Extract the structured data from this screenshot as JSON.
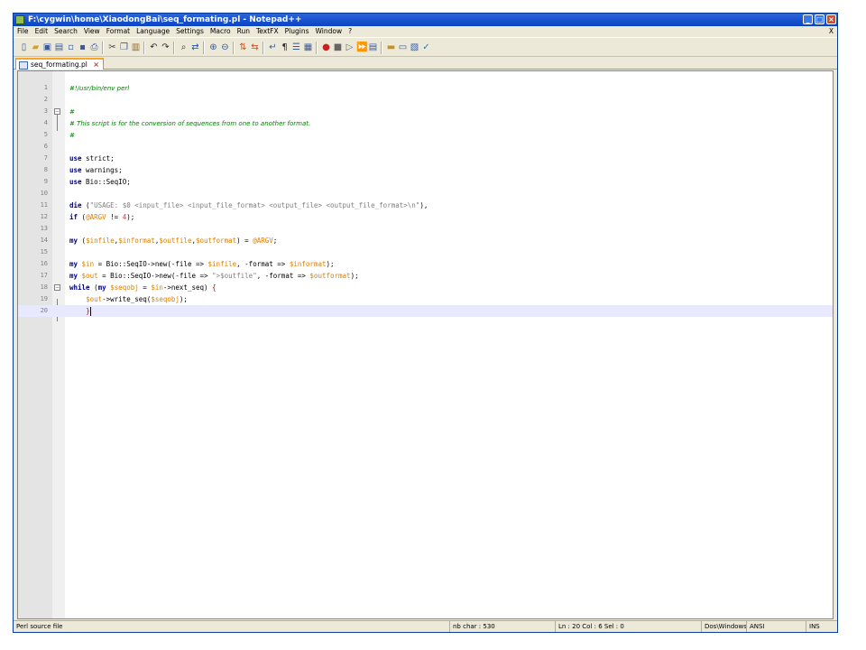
{
  "window": {
    "title": "F:\\cygwin\\home\\XiaodongBai\\seq_formating.pl - Notepad++",
    "controls": {
      "minimize": "_",
      "maximize": "□",
      "close": "×"
    }
  },
  "menu": {
    "items": [
      "File",
      "Edit",
      "Search",
      "View",
      "Format",
      "Language",
      "Settings",
      "Macro",
      "Run",
      "TextFX",
      "Plugins",
      "Window",
      "?"
    ],
    "close_doc": "X"
  },
  "toolbar": {
    "icons": [
      "new-file-icon",
      "open-file-icon",
      "save-icon",
      "save-all-icon",
      "close-icon",
      "close-all-icon",
      "print-icon",
      "cut-icon",
      "copy-icon",
      "paste-icon",
      "undo-icon",
      "redo-icon",
      "find-icon",
      "replace-icon",
      "zoom-in-icon",
      "zoom-out-icon",
      "sync-v-icon",
      "sync-h-icon",
      "wrap-icon",
      "all-chars-icon",
      "indent-guide-icon",
      "doc-map-icon",
      "record-macro-icon",
      "stop-macro-icon",
      "play-macro-icon",
      "run-macro-multi-icon",
      "save-macro-icon",
      "tool-a-icon",
      "tool-b-icon",
      "tool-c-icon",
      "tool-d-icon"
    ]
  },
  "tabs": [
    {
      "label": "seq_formating.pl",
      "close": "×"
    }
  ],
  "editor": {
    "lines": [
      {
        "n": "1",
        "segs": [
          {
            "t": "#!/usr/bin/env perl",
            "c": "cmt"
          }
        ]
      },
      {
        "n": "2",
        "segs": []
      },
      {
        "n": "3",
        "segs": [
          {
            "t": "#",
            "c": "cmt"
          }
        ]
      },
      {
        "n": "4",
        "segs": [
          {
            "t": "# This script is for the conversion of sequences from one to another format.",
            "c": "cmt"
          }
        ]
      },
      {
        "n": "5",
        "segs": [
          {
            "t": "#",
            "c": "cmt"
          }
        ]
      },
      {
        "n": "6",
        "segs": []
      },
      {
        "n": "7",
        "segs": [
          {
            "t": "use",
            "c": "kw"
          },
          {
            "t": " strict;",
            "c": ""
          }
        ]
      },
      {
        "n": "8",
        "segs": [
          {
            "t": "use",
            "c": "kw"
          },
          {
            "t": " warnings;",
            "c": ""
          }
        ]
      },
      {
        "n": "9",
        "segs": [
          {
            "t": "use",
            "c": "kw"
          },
          {
            "t": " Bio::SeqIO;",
            "c": ""
          }
        ]
      },
      {
        "n": "10",
        "segs": []
      },
      {
        "n": "11",
        "segs": [
          {
            "t": "die",
            "c": "kw"
          },
          {
            "t": " (",
            "c": ""
          },
          {
            "t": "\"USAGE: $0 <input_file> <input_file_format> <output_file> <output_file_format>\\n\"",
            "c": "str"
          },
          {
            "t": "),",
            "c": ""
          }
        ]
      },
      {
        "n": "12",
        "segs": [
          {
            "t": "if",
            "c": "kw"
          },
          {
            "t": " (",
            "c": ""
          },
          {
            "t": "@ARGV",
            "c": "var"
          },
          {
            "t": " != ",
            "c": ""
          },
          {
            "t": "4",
            "c": "num"
          },
          {
            "t": ");",
            "c": ""
          }
        ]
      },
      {
        "n": "13",
        "segs": []
      },
      {
        "n": "14",
        "segs": [
          {
            "t": "my",
            "c": "kw"
          },
          {
            "t": " (",
            "c": ""
          },
          {
            "t": "$infile",
            "c": "var"
          },
          {
            "t": ",",
            "c": ""
          },
          {
            "t": "$informat",
            "c": "var"
          },
          {
            "t": ",",
            "c": ""
          },
          {
            "t": "$outfile",
            "c": "var"
          },
          {
            "t": ",",
            "c": ""
          },
          {
            "t": "$outformat",
            "c": "var"
          },
          {
            "t": ") = ",
            "c": ""
          },
          {
            "t": "@ARGV",
            "c": "var"
          },
          {
            "t": ";",
            "c": ""
          }
        ]
      },
      {
        "n": "15",
        "segs": []
      },
      {
        "n": "16",
        "segs": [
          {
            "t": "my",
            "c": "kw"
          },
          {
            "t": " ",
            "c": ""
          },
          {
            "t": "$in",
            "c": "var"
          },
          {
            "t": " = Bio::SeqIO->new(-file => ",
            "c": ""
          },
          {
            "t": "$infile",
            "c": "var"
          },
          {
            "t": ", -format => ",
            "c": ""
          },
          {
            "t": "$informat",
            "c": "var"
          },
          {
            "t": ");",
            "c": ""
          }
        ]
      },
      {
        "n": "17",
        "segs": [
          {
            "t": "my",
            "c": "kw"
          },
          {
            "t": " ",
            "c": ""
          },
          {
            "t": "$out",
            "c": "var"
          },
          {
            "t": " = Bio::SeqIO->new(-file => ",
            "c": ""
          },
          {
            "t": "\">$outfile\"",
            "c": "str"
          },
          {
            "t": ", -format => ",
            "c": ""
          },
          {
            "t": "$outformat",
            "c": "var"
          },
          {
            "t": ");",
            "c": ""
          }
        ]
      },
      {
        "n": "18",
        "segs": [
          {
            "t": "while",
            "c": "kw"
          },
          {
            "t": " (",
            "c": ""
          },
          {
            "t": "my",
            "c": "kw"
          },
          {
            "t": " ",
            "c": ""
          },
          {
            "t": "$seqobj",
            "c": "var"
          },
          {
            "t": " = ",
            "c": ""
          },
          {
            "t": "$in",
            "c": "var"
          },
          {
            "t": "->next_seq) ",
            "c": ""
          },
          {
            "t": "{",
            "c": "br"
          }
        ]
      },
      {
        "n": "19",
        "segs": [
          {
            "t": "    ",
            "c": ""
          },
          {
            "t": "$out",
            "c": "var"
          },
          {
            "t": "->write_seq(",
            "c": ""
          },
          {
            "t": "$seqobj",
            "c": "var"
          },
          {
            "t": ");",
            "c": ""
          }
        ]
      },
      {
        "n": "20",
        "segs": [
          {
            "t": "    ",
            "c": ""
          },
          {
            "t": "}",
            "c": "br"
          }
        ]
      }
    ],
    "current_line": "20"
  },
  "status": {
    "language": "Perl source file",
    "length": "nb char : 530",
    "position": "Ln : 20   Col : 6   Sel : 0",
    "eol": "Dos\\Windows",
    "encoding": "ANSI",
    "mode": "INS"
  }
}
